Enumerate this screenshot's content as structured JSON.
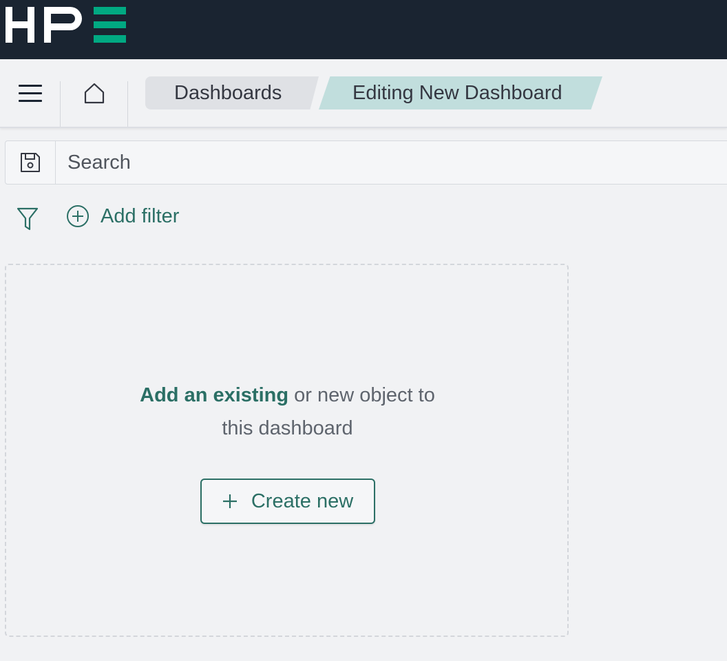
{
  "brand": {
    "logo_text": "HPE",
    "bar_color": "#1a2431",
    "accent_color": "#01a982"
  },
  "navbar": {
    "menu_icon": "hamburger-icon",
    "home_icon": "home-icon",
    "breadcrumbs": [
      {
        "label": "Dashboards"
      },
      {
        "label": "Editing New Dashboard"
      }
    ]
  },
  "query_bar": {
    "save_icon": "floppy-disk-icon",
    "search_placeholder": "Search",
    "search_value": ""
  },
  "filters": {
    "filter_icon": "funnel-icon",
    "add_filter_icon": "plus-circle-icon",
    "add_filter_label": "Add filter"
  },
  "empty_panel": {
    "link_text": "Add an existing",
    "text_rest": " or new object to",
    "text_line2": "this dashboard",
    "create_button_label": "Create new",
    "create_icon": "plus-icon"
  },
  "colors": {
    "primary": "#2b6f65",
    "active_crumb": "#c1dedd",
    "inactive_crumb": "#dfe1e5",
    "page_background": "#f1f2f4"
  }
}
